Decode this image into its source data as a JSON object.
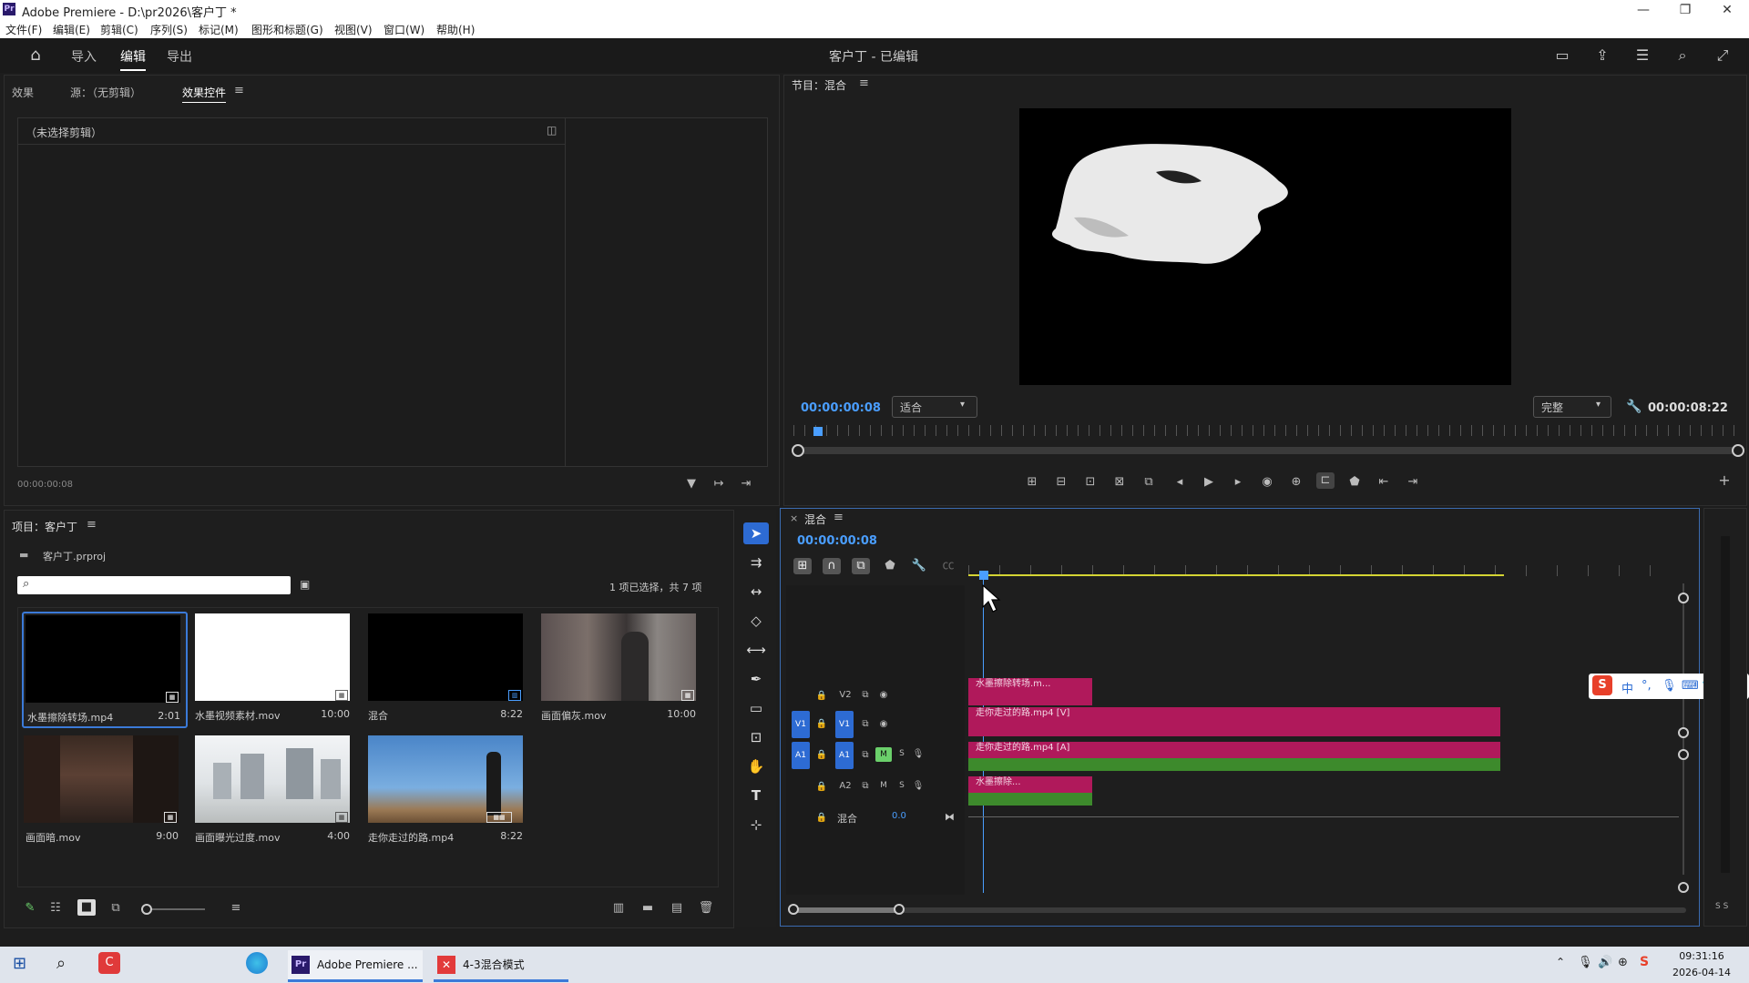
{
  "window": {
    "title": "Adobe Premiere - D:\\pr2026\\客户丁 *",
    "minimize": "—",
    "restore": "❐",
    "close": "✕"
  },
  "menu": [
    "文件(F)",
    "编辑(E)",
    "剪辑(C)",
    "序列(S)",
    "标记(M)",
    "图形和标题(G)",
    "视图(V)",
    "窗口(W)",
    "帮助(H)"
  ],
  "header": {
    "tabs": [
      "导入",
      "编辑",
      "导出"
    ],
    "active_tab": "编辑",
    "doc_title": "客户丁 - 已编辑"
  },
  "effects_panel": {
    "tabs": [
      "效果",
      "源：（无剪辑）",
      "效果控件"
    ],
    "active_tab": "效果控件",
    "no_clip_label": "（未选择剪辑）",
    "timecode": "00:00:00:08"
  },
  "program_monitor": {
    "title": "节目：混合",
    "current_time": "00:00:00:08",
    "zoom": "适合",
    "quality": "完整",
    "duration": "00:00:08:22"
  },
  "project_panel": {
    "title": "项目：客户丁",
    "file": "客户丁.prproj",
    "search_placeholder": "",
    "selection_info": "1 项已选择，共 7 项",
    "items": [
      {
        "name": "水墨擦除转场.mp4",
        "duration": "2:01"
      },
      {
        "name": "水墨视频素材.mov",
        "duration": "10:00"
      },
      {
        "name": "混合",
        "duration": "8:22"
      },
      {
        "name": "画面偏灰.mov",
        "duration": "10:00"
      },
      {
        "name": "画面暗.mov",
        "duration": "9:00"
      },
      {
        "name": "画面曝光过度.mov",
        "duration": "4:00"
      },
      {
        "name": "走你走过的路.mp4",
        "duration": "8:22"
      }
    ]
  },
  "timeline": {
    "tab": "混合",
    "timecode": "00:00:00:08",
    "tracks": {
      "v2": "V2",
      "v1_src": "V1",
      "v1": "V1",
      "a1_src": "A1",
      "a1": "A1",
      "a2": "A2",
      "mix_label": "混合",
      "mix_value": "0.0",
      "m": "M",
      "s": "S"
    },
    "clips": {
      "v2_clip": "水墨擦除转场.m...",
      "v1_clip": "走你走过的路.mp4 [V]",
      "a1_clip": "走你走过的路.mp4 [A]",
      "a2_clip": "水墨擦除..."
    },
    "meter_label": "S S"
  },
  "taskbar": {
    "apps": [
      "Adobe Premiere ...",
      "4-3混合模式"
    ],
    "time": "09:31:16",
    "date": "2026-04-14"
  },
  "ime": {
    "label": "中"
  }
}
